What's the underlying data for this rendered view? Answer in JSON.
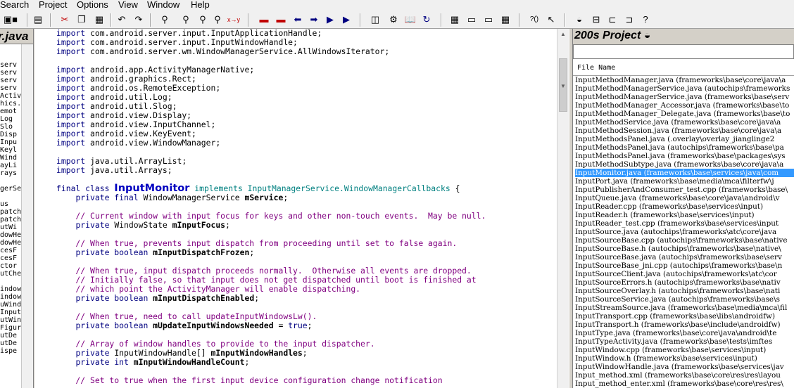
{
  "menu": [
    "Search",
    "Project",
    "Options",
    "View",
    "Window",
    "Help"
  ],
  "left_panel": {
    "title": "r.java",
    "items": [
      "serv",
      "serv",
      "serv",
      "serv",
      "Activ",
      "hics.",
      "emot",
      "Log",
      "Slo",
      "Disp",
      "Inpu",
      "Keyl",
      "Wind",
      "ayLi",
      "rays",
      "",
      "gerSe",
      "",
      "us",
      "patch",
      "patch",
      "utWi",
      "dowHe",
      "dowHe",
      "cesF",
      "cesF",
      "ctor",
      "utChe",
      "",
      "indow",
      "indow",
      "uWind",
      "Input",
      "utWin",
      "Figur",
      "utDe",
      "utDe",
      "ispe"
    ]
  },
  "code_lines": [
    [
      [
        "im",
        "import "
      ],
      [
        "ty",
        "com.android.server.input.InputApplicationHandle;"
      ]
    ],
    [
      [
        "im",
        "import "
      ],
      [
        "ty",
        "com.android.server.input.InputWindowHandle;"
      ]
    ],
    [
      [
        "im",
        "import "
      ],
      [
        "ty",
        "com.android.server.wm.WindowManagerService.AllWindowsIterator;"
      ]
    ],
    [],
    [
      [
        "im",
        "import "
      ],
      [
        "ty",
        "android.app.ActivityManagerNative;"
      ]
    ],
    [
      [
        "im",
        "import "
      ],
      [
        "ty",
        "android.graphics.Rect;"
      ]
    ],
    [
      [
        "im",
        "import "
      ],
      [
        "ty",
        "android.os.RemoteException;"
      ]
    ],
    [
      [
        "im",
        "import "
      ],
      [
        "ty",
        "android.util.Log;"
      ]
    ],
    [
      [
        "im",
        "import "
      ],
      [
        "ty",
        "android.util.Slog;"
      ]
    ],
    [
      [
        "im",
        "import "
      ],
      [
        "ty",
        "android.view.Display;"
      ]
    ],
    [
      [
        "im",
        "import "
      ],
      [
        "ty",
        "android.view.InputChannel;"
      ]
    ],
    [
      [
        "im",
        "import "
      ],
      [
        "ty",
        "android.view.KeyEvent;"
      ]
    ],
    [
      [
        "im",
        "import "
      ],
      [
        "ty",
        "android.view.WindowManager;"
      ]
    ],
    [],
    [
      [
        "im",
        "import "
      ],
      [
        "ty",
        "java.util.ArrayList;"
      ]
    ],
    [
      [
        "im",
        "import "
      ],
      [
        "ty",
        "java.util.Arrays;"
      ]
    ],
    [],
    [
      [
        "kw",
        "final class "
      ],
      [
        "big",
        "InputMonitor"
      ],
      [
        "hi",
        " implements InputManagerService.WindowManagerCallbacks "
      ],
      [
        "ty",
        "{"
      ]
    ],
    [
      [
        "ty",
        "    "
      ],
      [
        "kw",
        "private final "
      ],
      [
        "ty",
        "WindowManagerService "
      ],
      [
        "field",
        "mService"
      ],
      [
        "ty",
        ";"
      ]
    ],
    [],
    [
      [
        "cm",
        "    // Current window with input focus for keys and other non-touch events.  May be null."
      ]
    ],
    [
      [
        "ty",
        "    "
      ],
      [
        "kw",
        "private "
      ],
      [
        "ty",
        "WindowState "
      ],
      [
        "field",
        "mInputFocus"
      ],
      [
        "ty",
        ";"
      ]
    ],
    [],
    [
      [
        "cm",
        "    // When true, prevents input dispatch from proceeding until set to false again."
      ]
    ],
    [
      [
        "ty",
        "    "
      ],
      [
        "kw",
        "private boolean "
      ],
      [
        "field",
        "mInputDispatchFrozen"
      ],
      [
        "ty",
        ";"
      ]
    ],
    [],
    [
      [
        "cm",
        "    // When true, input dispatch proceeds normally.  Otherwise all events are dropped."
      ]
    ],
    [
      [
        "cm",
        "    // Initially false, so that input does not get dispatched until boot is finished at"
      ]
    ],
    [
      [
        "cm",
        "    // which point the ActivityManager will enable dispatching."
      ]
    ],
    [
      [
        "ty",
        "    "
      ],
      [
        "kw",
        "private boolean "
      ],
      [
        "field",
        "mInputDispatchEnabled"
      ],
      [
        "ty",
        ";"
      ]
    ],
    [],
    [
      [
        "cm",
        "    // When true, need to call updateInputWindowsLw()."
      ]
    ],
    [
      [
        "ty",
        "    "
      ],
      [
        "kw",
        "private boolean "
      ],
      [
        "field",
        "mUpdateInputWindowsNeeded"
      ],
      [
        "ty",
        " = "
      ],
      [
        "kw",
        "true"
      ],
      [
        "ty",
        ";"
      ]
    ],
    [],
    [
      [
        "cm",
        "    // Array of window handles to provide to the input dispatcher."
      ]
    ],
    [
      [
        "ty",
        "    "
      ],
      [
        "kw",
        "private "
      ],
      [
        "ty",
        "InputWindowHandle[] "
      ],
      [
        "field",
        "mInputWindowHandles"
      ],
      [
        "ty",
        ";"
      ]
    ],
    [
      [
        "ty",
        "    "
      ],
      [
        "kw",
        "private int "
      ],
      [
        "field",
        "mInputWindowHandleCount"
      ],
      [
        "ty",
        ";"
      ]
    ],
    [],
    [
      [
        "cm",
        "    // Set to true when the first input device configuration change notification"
      ]
    ]
  ],
  "project": {
    "title": "200s Project",
    "column_header": "File Name",
    "selected_index": 11,
    "files": [
      "InputMethodManager.java (frameworks\\base\\core\\java\\a",
      "InputMethodManagerService.java (autochips\\frameworks",
      "InputMethodManagerService.java (frameworks\\base\\serv",
      "InputMethodManager_Accessor.java (frameworks\\base\\to",
      "InputMethodManager_Delegate.java (frameworks\\base\\to",
      "InputMethodService.java (frameworks\\base\\core\\java\\a",
      "InputMethodSession.java (frameworks\\base\\core\\java\\a",
      "InputMethodsPanel.java (.overlay\\overlay_jianglinge2",
      "InputMethodsPanel.java (autochips\\frameworks\\base\\pa",
      "InputMethodsPanel.java (frameworks\\base\\packages\\sys",
      "InputMethodSubtype.java (frameworks\\base\\core\\java\\a",
      "InputMonitor.java (frameworks\\base\\services\\java\\com",
      "InputPort.java (frameworks\\base\\media\\mca\\filterfw\\j",
      "InputPublisherAndConsumer_test.cpp (frameworks\\base\\",
      "InputQueue.java (frameworks\\base\\core\\java\\android\\v",
      "InputReader.cpp (frameworks\\base\\services\\input)",
      "InputReader.h (frameworks\\base\\services\\input)",
      "InputReader_test.cpp (frameworks\\base\\services\\input",
      "InputSource.java (autochips\\frameworks\\atc\\core\\java",
      "InputSourceBase.cpp (autochips\\frameworks\\base\\native",
      "InputSourceBase.h (autochips\\frameworks\\base\\native\\",
      "InputSourceBase.java (autochips\\frameworks\\base\\serv",
      "InputSourceBase_jni.cpp (autochips\\frameworks\\base\\n",
      "InputSourceClient.java (autochips\\frameworks\\atc\\cor",
      "InputSourceErrors.h (autochips\\frameworks\\base\\nativ",
      "InputSourceOverlay.h (autochips\\frameworks\\base\\nati",
      "InputSourceService.java (autochips\\frameworks\\base\\s",
      "InputStreamSource.java (frameworks\\base\\media\\mca\\fil",
      "InputTransport.cpp (frameworks\\base\\libs\\androidfw)",
      "InputTransport.h (frameworks\\base\\include\\androidfw)",
      "InputType.java (frameworks\\base\\core\\java\\android\\te",
      "InputTypeActivity.java (frameworks\\base\\tests\\imftes",
      "InputWindow.cpp (frameworks\\base\\services\\input)",
      "InputWindow.h (frameworks\\base\\services\\input)",
      "InputWindowHandle.java (frameworks\\base\\services\\jav",
      "Input_method.xml (frameworks\\base\\core\\res\\res\\layou",
      "Input_method_enter.xml (frameworks\\base\\core\\res\\res\\"
    ]
  },
  "toolbar_icons": [
    "new-file-icon",
    "save-icon",
    "print-icon",
    "cut-icon",
    "copy-icon",
    "paste-icon",
    "undo-icon",
    "redo-icon",
    "find-icon",
    "find-prev-icon",
    "find-next-icon",
    "find-files-icon",
    "replace-icon",
    "bookmark-icon",
    "bookmark-toggle-icon",
    "back-icon",
    "forward-icon",
    "jump-icon",
    "jump-list-icon",
    "symbol-window-icon",
    "relation-icon",
    "project-icon",
    "refresh-icon",
    "layout-1-icon",
    "layout-2-icon",
    "layout-3-icon",
    "layout-4-icon",
    "help-icon",
    "context-help-icon",
    "panel-toggle-icon",
    "panel-float-icon",
    "panel-split-icon",
    "panel-sync-icon",
    "panel-info-icon"
  ]
}
